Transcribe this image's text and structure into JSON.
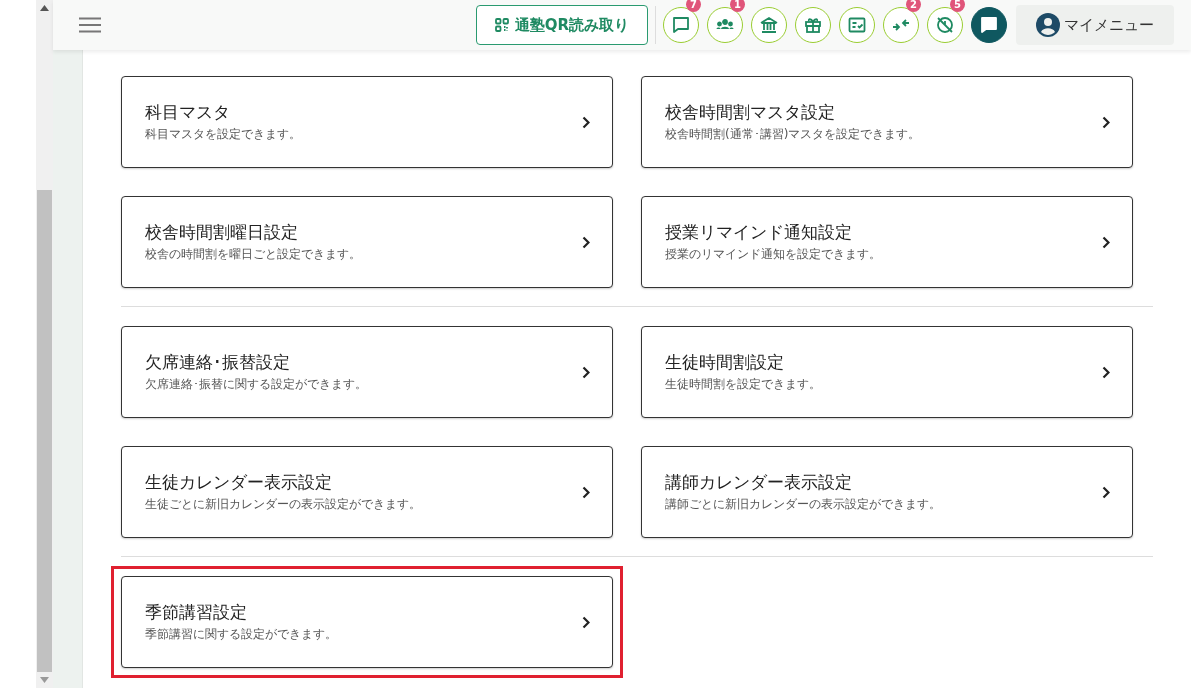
{
  "header": {
    "qr_button": {
      "label": "通塾QR読み取り"
    },
    "icon_buttons": [
      {
        "kind": "chat",
        "badge": "7"
      },
      {
        "kind": "people",
        "badge": "1"
      },
      {
        "kind": "school"
      },
      {
        "kind": "gift"
      },
      {
        "kind": "checklist"
      },
      {
        "kind": "arrows",
        "badge": "2"
      },
      {
        "kind": "clock-off",
        "badge": "5"
      },
      {
        "kind": "chat-filled"
      }
    ],
    "my_menu": {
      "label": "マイメニュー"
    }
  },
  "sections": [
    {
      "cards": [
        {
          "title": "科目マスタ",
          "description": "科目マスタを設定できます。",
          "highlighted": false
        },
        {
          "title": "校舎時間割マスタ設定",
          "description": "校舎時間割(通常･講習)マスタを設定できます。",
          "highlighted": false
        },
        {
          "title": "校舎時間割曜日設定",
          "description": "校舎の時間割を曜日ごと設定できます。",
          "highlighted": false
        },
        {
          "title": "授業リマインド通知設定",
          "description": "授業のリマインド通知を設定できます。",
          "highlighted": false
        }
      ]
    },
    {
      "cards": [
        {
          "title": "欠席連絡･振替設定",
          "description": "欠席連絡･振替に関する設定ができます。",
          "highlighted": false
        },
        {
          "title": "生徒時間割設定",
          "description": "生徒時間割を設定できます。",
          "highlighted": false
        },
        {
          "title": "生徒カレンダー表示設定",
          "description": "生徒ごとに新旧カレンダーの表示設定ができます。",
          "highlighted": false
        },
        {
          "title": "講師カレンダー表示設定",
          "description": "講師ごとに新旧カレンダーの表示設定ができます。",
          "highlighted": false
        }
      ]
    },
    {
      "cards": [
        {
          "title": "季節講習設定",
          "description": "季節講習に関する設定ができます。",
          "highlighted": true
        }
      ]
    }
  ]
}
